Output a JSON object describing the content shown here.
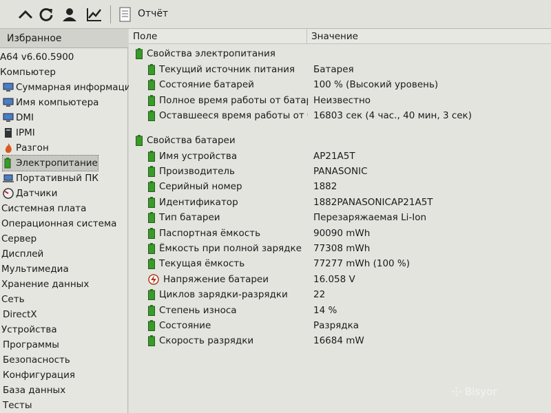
{
  "toolbar": {
    "report_label": "Отчёт",
    "buttons": [
      "up-icon",
      "refresh-icon",
      "user-icon",
      "chart-icon"
    ]
  },
  "sidebar": {
    "header": "Избранное",
    "items": [
      {
        "label": "A64 v6.60.5900",
        "icon": ""
      },
      {
        "label": "Компьютер",
        "icon": ""
      },
      {
        "label": "Суммарная информация",
        "icon": "computer-icon"
      },
      {
        "label": "Имя компьютера",
        "icon": "computer-icon"
      },
      {
        "label": "DMI",
        "icon": "computer-icon"
      },
      {
        "label": "IPMI",
        "icon": "server-icon"
      },
      {
        "label": "Разгон",
        "icon": "flame-icon"
      },
      {
        "label": "Электропитание",
        "icon": "battery-icon"
      },
      {
        "label": "Портативный ПК",
        "icon": "laptop-icon"
      },
      {
        "label": "Датчики",
        "icon": "gauge-icon"
      },
      {
        "label": "Системная плата",
        "icon": ""
      },
      {
        "label": "Операционная система",
        "icon": ""
      },
      {
        "label": "Сервер",
        "icon": ""
      },
      {
        "label": "Дисплей",
        "icon": ""
      },
      {
        "label": "Мультимедиа",
        "icon": ""
      },
      {
        "label": "Хранение данных",
        "icon": ""
      },
      {
        "label": "Сеть",
        "icon": ""
      },
      {
        "label": "DirectX",
        "icon": ""
      },
      {
        "label": "Устройства",
        "icon": ""
      },
      {
        "label": "Программы",
        "icon": ""
      },
      {
        "label": "Безопасность",
        "icon": ""
      },
      {
        "label": "Конфигурация",
        "icon": ""
      },
      {
        "label": "База данных",
        "icon": ""
      },
      {
        "label": "Тесты",
        "icon": ""
      }
    ],
    "selected": "Электропитание"
  },
  "table": {
    "col_field": "Поле",
    "col_value": "Значение",
    "groups": [
      {
        "title": "Свойства электропитания",
        "rows": [
          {
            "field": "Текущий источник питания",
            "value": "Батарея"
          },
          {
            "field": "Состояние батарей",
            "value": "100 % (Высокий уровень)"
          },
          {
            "field": "Полное время работы от батар...",
            "value": "Неизвестно"
          },
          {
            "field": "Оставшееся время работы от б...",
            "value": "16803 сек (4 час., 40 мин, 3 сек)"
          }
        ]
      },
      {
        "title": "Свойства батареи",
        "rows": [
          {
            "field": "Имя устройства",
            "value": "AP21A5T"
          },
          {
            "field": "Производитель",
            "value": "PANASONIC"
          },
          {
            "field": "Серийный номер",
            "value": "1882"
          },
          {
            "field": "Идентификатор",
            "value": "1882PANASONICAP21A5T"
          },
          {
            "field": "Тип батареи",
            "value": "Перезаряжаемая Li-Ion"
          },
          {
            "field": "Паспортная ёмкость",
            "value": "90090 mWh"
          },
          {
            "field": "Ёмкость при полной зарядке",
            "value": "77308 mWh"
          },
          {
            "field": "Текущая ёмкость",
            "value": "77277 mWh  (100 %)"
          },
          {
            "field": "Напряжение батареи",
            "value": "16.058 V",
            "icon": "voltage-icon"
          },
          {
            "field": "Циклов зарядки-разрядки",
            "value": "22"
          },
          {
            "field": "Степень износа",
            "value": "14 %"
          },
          {
            "field": "Состояние",
            "value": "Разрядка"
          },
          {
            "field": "Скорость разрядки",
            "value": "16684 mW"
          }
        ]
      }
    ]
  },
  "watermark": "Bisyor",
  "colors": {
    "battery_green": "#3a9a2a",
    "selection": "#c8c8c2"
  }
}
